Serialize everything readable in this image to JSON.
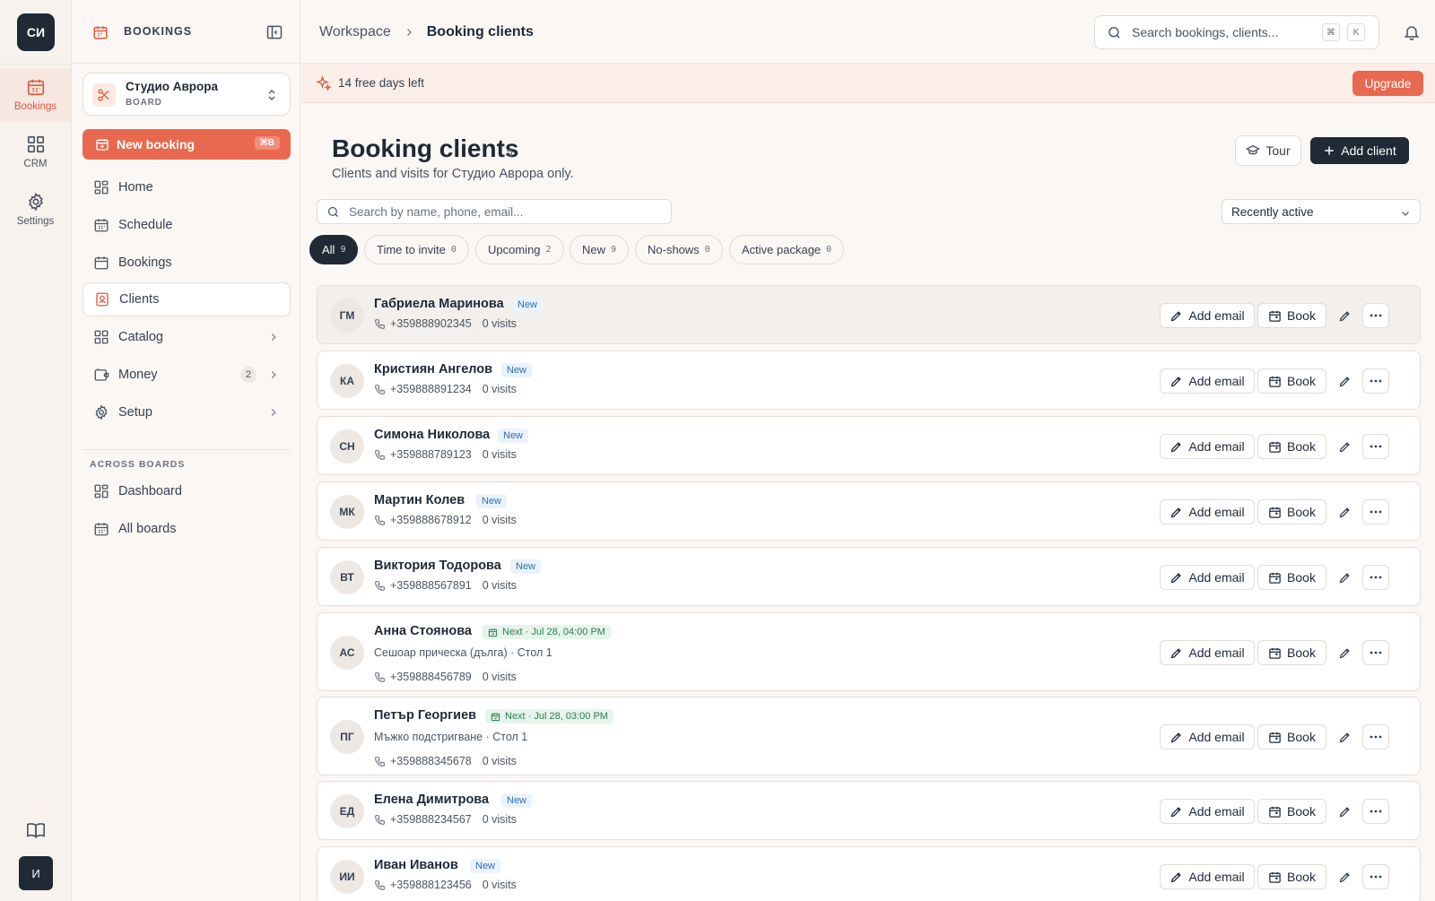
{
  "rail": {
    "logo": "СИ",
    "items": [
      {
        "label": "Bookings"
      },
      {
        "label": "CRM"
      },
      {
        "label": "Settings"
      }
    ],
    "user_initial": "И",
    "icons": {
      "bookings": "calendar-icon",
      "crm": "grid-icon",
      "settings": "gear-icon",
      "docs": "book-open-icon"
    }
  },
  "sidebar": {
    "header": "BOOKINGS",
    "board": {
      "name": "Студио Аврора",
      "type": "BOARD"
    },
    "new_booking": {
      "label": "New booking",
      "shortcut": "⌘B"
    },
    "nav": [
      {
        "label": "Home"
      },
      {
        "label": "Schedule"
      },
      {
        "label": "Bookings"
      },
      {
        "label": "Clients"
      },
      {
        "label": "Catalog"
      },
      {
        "label": "Money",
        "count": "2"
      },
      {
        "label": "Setup"
      }
    ],
    "section_label": "ACROSS BOARDS",
    "across": [
      {
        "label": "Dashboard"
      },
      {
        "label": "All boards"
      }
    ]
  },
  "topbar": {
    "breadcrumb": [
      "Workspace",
      "Booking clients"
    ],
    "search_placeholder": "Search bookings, clients...",
    "kbd": [
      "⌘",
      "K"
    ]
  },
  "trial": {
    "text": "14 free days left",
    "upgrade": "Upgrade"
  },
  "page": {
    "title": "Booking clients",
    "count": "9",
    "subtitle": "Clients and visits for Студио Аврора only.",
    "tour": "Tour",
    "add_client": "Add client",
    "search_placeholder": "Search by name, phone, email...",
    "sort": "Recently active"
  },
  "filters": [
    {
      "label": "All",
      "count": "9"
    },
    {
      "label": "Time to invite",
      "count": "0"
    },
    {
      "label": "Upcoming",
      "count": "2"
    },
    {
      "label": "New",
      "count": "9"
    },
    {
      "label": "No-shows",
      "count": "0"
    },
    {
      "label": "Active package",
      "count": "0"
    }
  ],
  "row_actions": {
    "add_email": "Add email",
    "book": "Book"
  },
  "clients": [
    {
      "initials": "ГМ",
      "name": "Габриела Маринова",
      "badge": "New",
      "phone": "+359888902345",
      "visits": "0 visits"
    },
    {
      "initials": "КА",
      "name": "Кристиян Ангелов",
      "badge": "New",
      "phone": "+359888891234",
      "visits": "0 visits"
    },
    {
      "initials": "СН",
      "name": "Симона Николова",
      "badge": "New",
      "phone": "+359888789123",
      "visits": "0 visits"
    },
    {
      "initials": "МК",
      "name": "Мартин Колев",
      "badge": "New",
      "phone": "+359888678912",
      "visits": "0 visits"
    },
    {
      "initials": "ВТ",
      "name": "Виктория Тодорова",
      "badge": "New",
      "phone": "+359888567891",
      "visits": "0 visits"
    },
    {
      "initials": "АС",
      "name": "Анна Стоянова",
      "next": "Next · Jul 28, 04:00 PM",
      "service": "Сешоар прическа (дълга) · Стол 1",
      "phone": "+359888456789",
      "visits": "0 visits"
    },
    {
      "initials": "ПГ",
      "name": "Петър Георгиев",
      "next": "Next · Jul 28, 03:00 PM",
      "service": "Мъжко подстригване · Стол 1",
      "phone": "+359888345678",
      "visits": "0 visits"
    },
    {
      "initials": "ЕД",
      "name": "Елена Димитрова",
      "badge": "New",
      "phone": "+359888234567",
      "visits": "0 visits"
    },
    {
      "initials": "ИИ",
      "name": "Иван Иванов",
      "badge": "New",
      "phone": "+359888123456",
      "visits": "0 visits"
    }
  ],
  "colors": {
    "accent": "#e8694f",
    "dark": "#1f2a36",
    "new_badge": "#2f6fb5",
    "next_badge": "#2e7d4f"
  }
}
